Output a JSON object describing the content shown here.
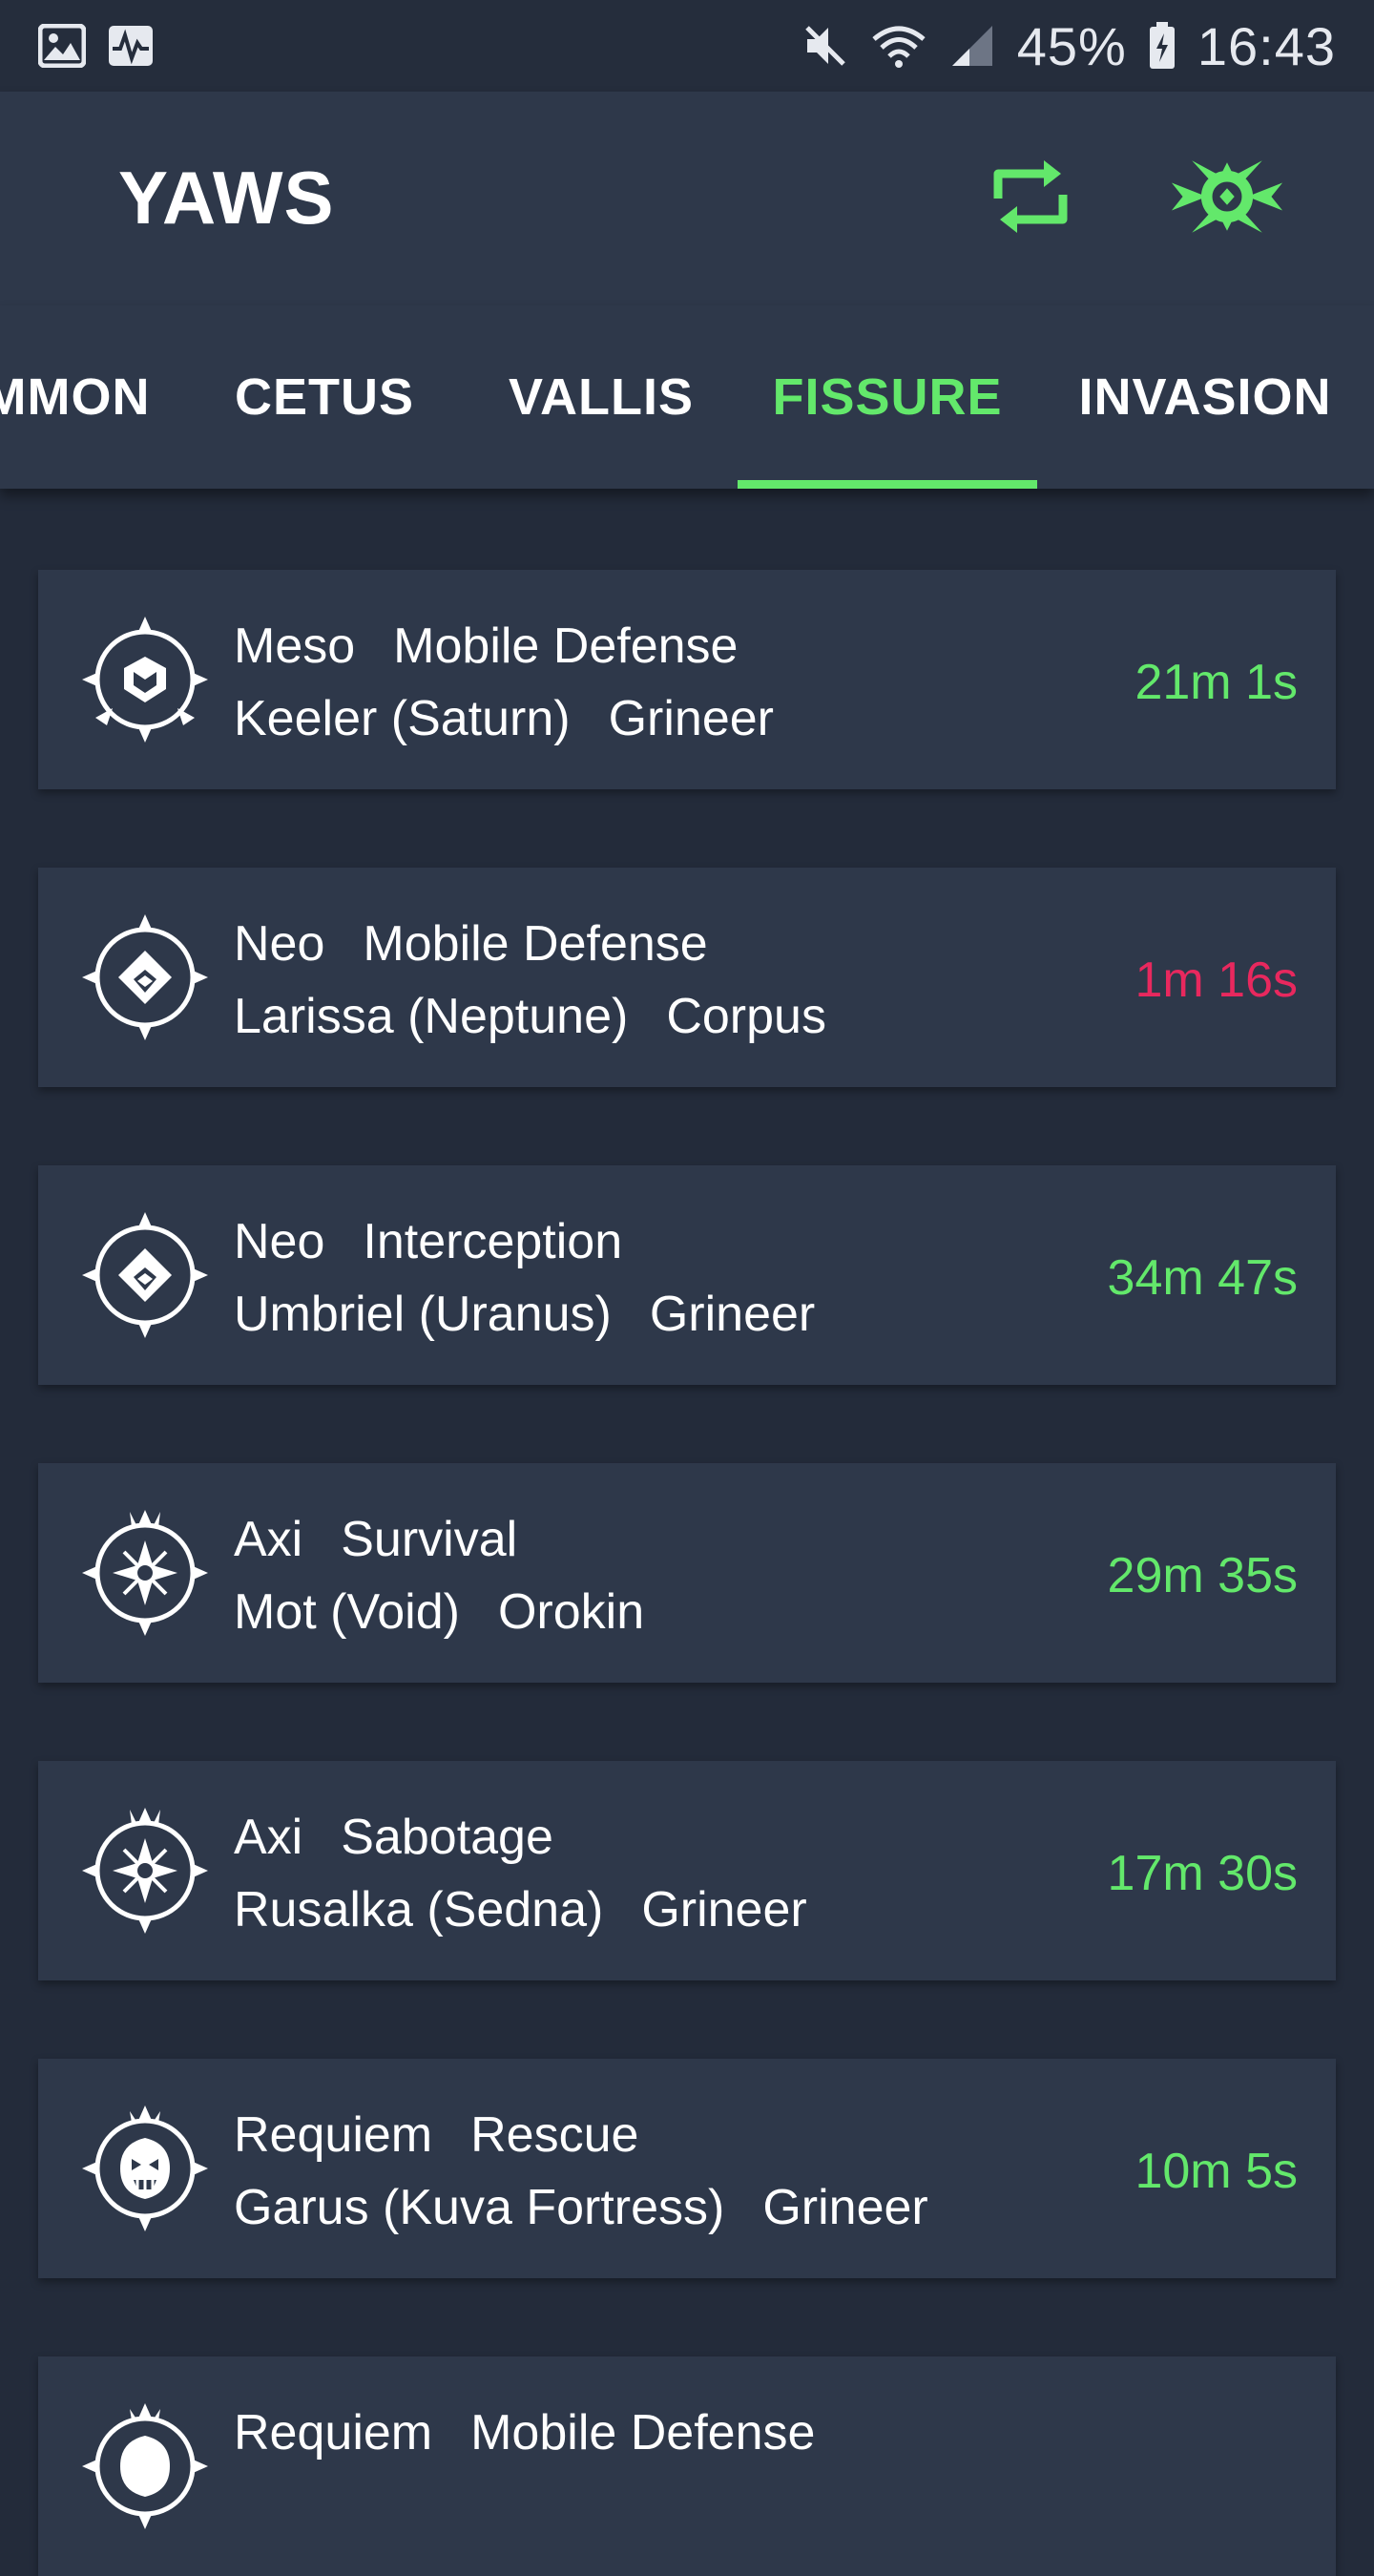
{
  "status_bar": {
    "battery": "45%",
    "time": "16:43"
  },
  "app": {
    "title": "YAWS",
    "sync_icon": "sync-icon",
    "faction_icon": "faction-icon"
  },
  "colors": {
    "accent": "#63e86b",
    "warning": "#e8285e",
    "surface": "#2e384a",
    "background": "#232b3a"
  },
  "tabs": [
    {
      "label": "MMON",
      "active": false
    },
    {
      "label": "CETUS",
      "active": false
    },
    {
      "label": "VALLIS",
      "active": false
    },
    {
      "label": "FISSURE",
      "active": true
    },
    {
      "label": "INVASION",
      "active": false
    }
  ],
  "fissures": [
    {
      "tier": "Meso",
      "mission": "Mobile Defense",
      "node": "Keeler (Saturn)",
      "faction": "Grineer",
      "timer": "21m 1s",
      "status": "normal",
      "icon": "meso-relic-icon"
    },
    {
      "tier": "Neo",
      "mission": "Mobile Defense",
      "node": "Larissa (Neptune)",
      "faction": "Corpus",
      "timer": "1m 16s",
      "status": "expiring",
      "icon": "neo-relic-icon"
    },
    {
      "tier": "Neo",
      "mission": "Interception",
      "node": "Umbriel (Uranus)",
      "faction": "Grineer",
      "timer": "34m 47s",
      "status": "normal",
      "icon": "neo-relic-icon"
    },
    {
      "tier": "Axi",
      "mission": "Survival",
      "node": "Mot (Void)",
      "faction": "Orokin",
      "timer": "29m 35s",
      "status": "normal",
      "icon": "axi-relic-icon"
    },
    {
      "tier": "Axi",
      "mission": "Sabotage",
      "node": "Rusalka (Sedna)",
      "faction": "Grineer",
      "timer": "17m 30s",
      "status": "normal",
      "icon": "axi-relic-icon"
    },
    {
      "tier": "Requiem",
      "mission": "Rescue",
      "node": "Garus (Kuva Fortress)",
      "faction": "Grineer",
      "timer": "10m 5s",
      "status": "normal",
      "icon": "requiem-relic-icon"
    },
    {
      "tier": "Requiem",
      "mission": "Mobile Defense",
      "node": "",
      "faction": "",
      "timer": "",
      "status": "normal",
      "icon": "requiem-relic-icon"
    }
  ]
}
